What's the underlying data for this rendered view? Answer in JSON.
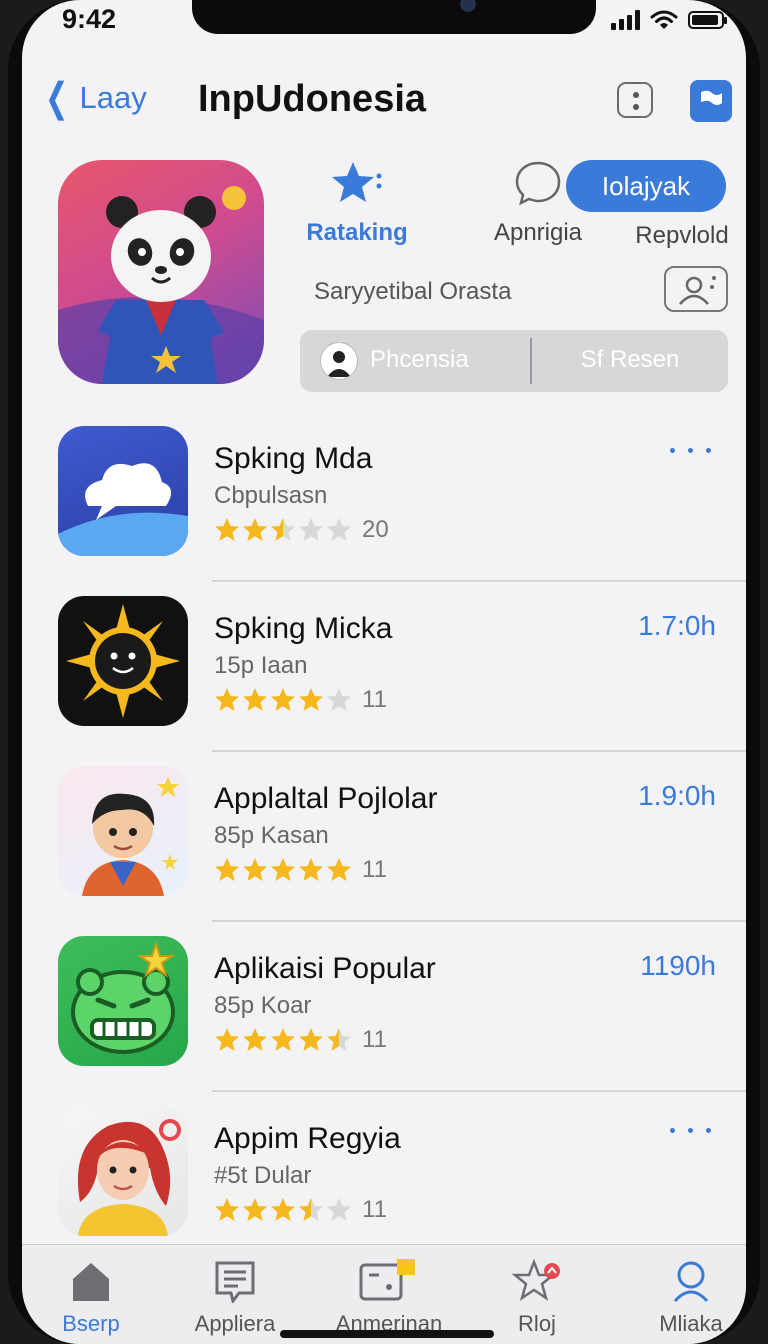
{
  "status": {
    "time": "9:42"
  },
  "nav": {
    "back_label": "Laay",
    "title": "InpUdonesia"
  },
  "hero": {
    "tabs": [
      {
        "label": "Rataking",
        "icon": "star-icon"
      },
      {
        "label": "Apnrigia",
        "icon": "chat-bubble-icon"
      },
      {
        "label": "Repvlold"
      }
    ],
    "get_label": "Iolajyak",
    "subtitle": "Saryyetibal Orasta",
    "segment": {
      "left": "Phcensia",
      "right": "Sf Resen"
    }
  },
  "apps": [
    {
      "name": "Spking Mda",
      "category": "Cbpulsasn",
      "rating": 2.5,
      "count": "20",
      "action": "more-dots"
    },
    {
      "name": "Spking Micka",
      "category": "15p Iaan",
      "rating": 4,
      "count": "11",
      "action": "1.7:0h"
    },
    {
      "name": "Applaltal Pojlolar",
      "category": "85p Kasan",
      "rating": 5,
      "count": "11",
      "action": "1.9:0h"
    },
    {
      "name": "Aplikaisi Popular",
      "category": "85p Koar",
      "rating": 4.5,
      "count": "11",
      "action": "1190h"
    },
    {
      "name": "Appim Regyia",
      "category": "#5t Dular",
      "rating": 3.5,
      "count": "11",
      "action": "more-dots"
    }
  ],
  "tabbar": [
    {
      "label": "Bserp",
      "icon": "home-icon",
      "active": true
    },
    {
      "label": "Appliera",
      "icon": "news-icon",
      "active": false
    },
    {
      "label": "Anmerinan",
      "icon": "arcade-icon",
      "active": false
    },
    {
      "label": "Rloj",
      "icon": "star-badge-icon",
      "active": false
    },
    {
      "label": "Mliaka",
      "icon": "search-icon",
      "active": false
    }
  ],
  "colors": {
    "accent": "#3a7ad9",
    "star": "#f5b81d",
    "star_empty": "#d8d8d8"
  }
}
